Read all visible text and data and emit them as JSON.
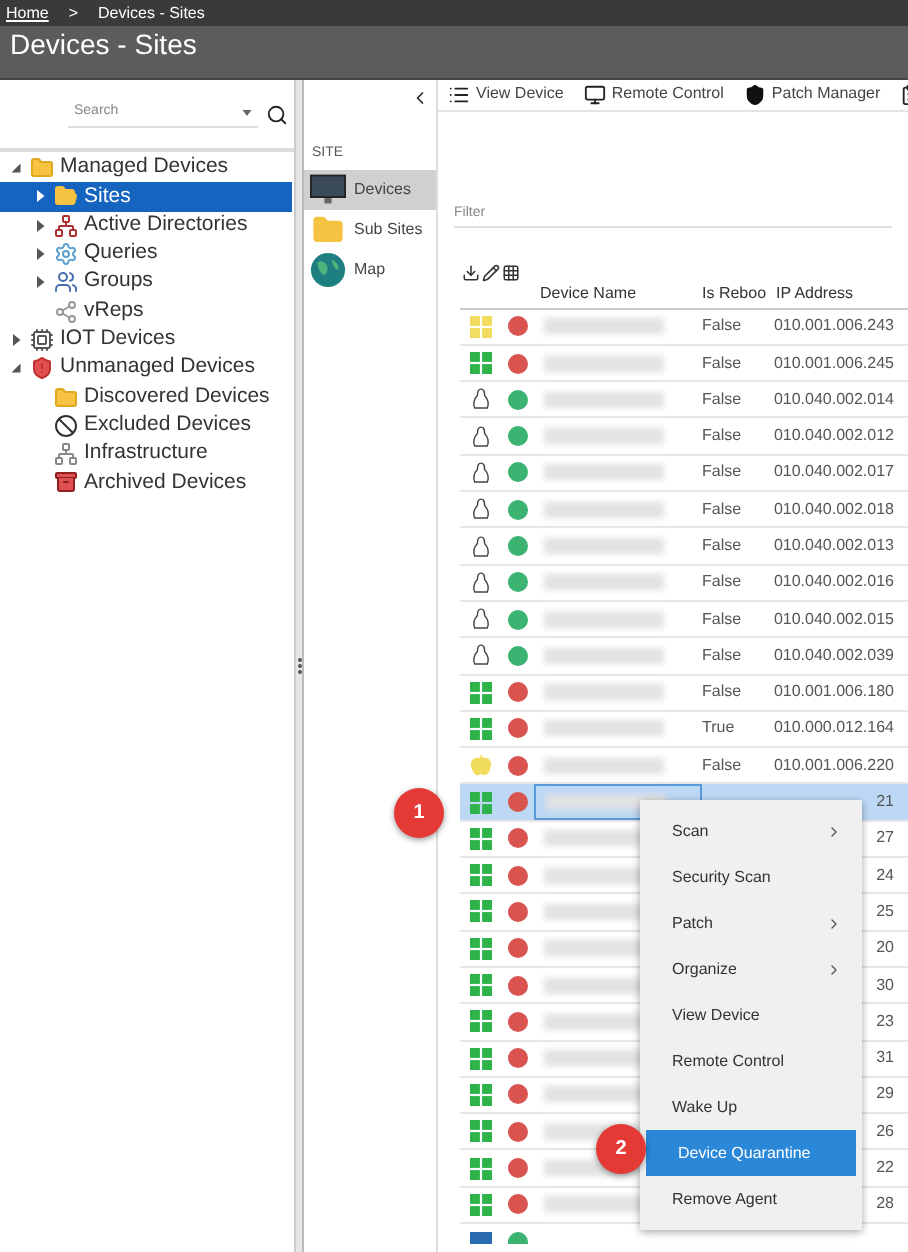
{
  "breadcrumb": {
    "home": "Home",
    "separator": ">",
    "current": "Devices - Sites"
  },
  "page_title": "Devices - Sites",
  "search": {
    "placeholder": "Search"
  },
  "tree": [
    {
      "label": "Managed Devices",
      "kind": "folder",
      "expanded": true,
      "selected": false,
      "children": [
        {
          "label": "Sites",
          "kind": "folder-open",
          "expanded": false,
          "selected": true
        },
        {
          "label": "Active Directories",
          "kind": "network",
          "expanded": false,
          "selected": false
        },
        {
          "label": "Queries",
          "kind": "gear",
          "expanded": false,
          "selected": false
        },
        {
          "label": "Groups",
          "kind": "groups",
          "expanded": false,
          "selected": false
        },
        {
          "label": "vReps",
          "kind": "vreps",
          "selected": false
        }
      ]
    },
    {
      "label": "IOT Devices",
      "kind": "iot",
      "expanded": false,
      "selected": false
    },
    {
      "label": "Unmanaged Devices",
      "kind": "unmanaged",
      "expanded": true,
      "selected": false,
      "children": [
        {
          "label": "Discovered Devices",
          "kind": "folder",
          "selected": false
        },
        {
          "label": "Excluded Devices",
          "kind": "excluded",
          "selected": false
        },
        {
          "label": "Infrastructure",
          "kind": "infrastructure",
          "selected": false
        },
        {
          "label": "Archived Devices",
          "kind": "archive",
          "selected": false
        }
      ]
    }
  ],
  "site_nav": {
    "heading": "SITE",
    "items": [
      {
        "label": "Devices",
        "kind": "monitor",
        "selected": true
      },
      {
        "label": "Sub Sites",
        "kind": "folder",
        "selected": false
      },
      {
        "label": "Map",
        "kind": "globe",
        "selected": false
      }
    ]
  },
  "toolbar": [
    {
      "label": "View Device",
      "kind": "list"
    },
    {
      "label": "Remote Control",
      "kind": "monitor"
    },
    {
      "label": "Patch Manager",
      "kind": "shield"
    },
    {
      "kind": "clipboard"
    }
  ],
  "filter": {
    "placeholder": "Filter"
  },
  "table": {
    "columns": [
      "Device Name",
      "Is Reboo",
      "IP Address"
    ],
    "rows": [
      {
        "kind": "windows-yellow",
        "color": "#d9534f",
        "reboot": "False",
        "ip": "010.001.006.243",
        "selected": false
      },
      {
        "kind": "windows",
        "color": "#d9534f",
        "reboot": "False",
        "ip": "010.001.006.245",
        "selected": false
      },
      {
        "kind": "linux",
        "color": "#3cb371",
        "reboot": "False",
        "ip": "010.040.002.014",
        "selected": false
      },
      {
        "kind": "linux",
        "color": "#3cb371",
        "reboot": "False",
        "ip": "010.040.002.012",
        "selected": false
      },
      {
        "kind": "linux",
        "color": "#3cb371",
        "reboot": "False",
        "ip": "010.040.002.017",
        "selected": false
      },
      {
        "kind": "linux",
        "color": "#3cb371",
        "reboot": "False",
        "ip": "010.040.002.018",
        "selected": false
      },
      {
        "kind": "linux",
        "color": "#3cb371",
        "reboot": "False",
        "ip": "010.040.002.013",
        "selected": false
      },
      {
        "kind": "linux",
        "color": "#3cb371",
        "reboot": "False",
        "ip": "010.040.002.016",
        "selected": false
      },
      {
        "kind": "linux",
        "color": "#3cb371",
        "reboot": "False",
        "ip": "010.040.002.015",
        "selected": false
      },
      {
        "kind": "linux",
        "color": "#3cb371",
        "reboot": "False",
        "ip": "010.040.002.039",
        "selected": false
      },
      {
        "kind": "windows",
        "color": "#d9534f",
        "reboot": "False",
        "ip": "010.001.006.180",
        "selected": false
      },
      {
        "kind": "windows",
        "color": "#d9534f",
        "reboot": "True",
        "ip": "010.000.012.164",
        "selected": false
      },
      {
        "kind": "apple",
        "color": "#d9534f",
        "reboot": "False",
        "ip": "010.001.006.220",
        "selected": false
      },
      {
        "kind": "windows",
        "color": "#d9534f",
        "ip": "21",
        "selected": true
      },
      {
        "kind": "windows",
        "color": "#d9534f",
        "ip": "27",
        "selected": false
      },
      {
        "kind": "windows",
        "color": "#d9534f",
        "ip": "24",
        "selected": false
      },
      {
        "kind": "windows",
        "color": "#d9534f",
        "ip": "25",
        "selected": false
      },
      {
        "kind": "windows",
        "color": "#d9534f",
        "ip": "20",
        "selected": false
      },
      {
        "kind": "windows",
        "color": "#d9534f",
        "ip": "30",
        "selected": false
      },
      {
        "kind": "windows",
        "color": "#d9534f",
        "ip": "23",
        "selected": false
      },
      {
        "kind": "windows",
        "color": "#d9534f",
        "ip": "31",
        "selected": false
      },
      {
        "kind": "windows",
        "color": "#d9534f",
        "ip": "29",
        "selected": false
      },
      {
        "kind": "windows",
        "color": "#d9534f",
        "ip": "26",
        "selected": false
      },
      {
        "kind": "windows",
        "color": "#d9534f",
        "ip": "22",
        "selected": false
      },
      {
        "kind": "windows",
        "color": "#d9534f",
        "ip": "28",
        "selected": false
      }
    ]
  },
  "context_menu": [
    {
      "label": "Scan",
      "submenu": true,
      "selected": false
    },
    {
      "label": "Security Scan",
      "submenu": false,
      "selected": false
    },
    {
      "label": "Patch",
      "submenu": true,
      "selected": false
    },
    {
      "label": "Organize",
      "submenu": true,
      "selected": false
    },
    {
      "label": "View Device",
      "submenu": false,
      "selected": false
    },
    {
      "label": "Remote Control",
      "submenu": false,
      "selected": false
    },
    {
      "label": "Wake Up",
      "submenu": false,
      "selected": false
    },
    {
      "label": "Device Quarantine",
      "submenu": false,
      "selected": true
    },
    {
      "label": "Remove Agent",
      "submenu": false,
      "selected": false
    }
  ],
  "step_badges": [
    "1",
    "2"
  ]
}
